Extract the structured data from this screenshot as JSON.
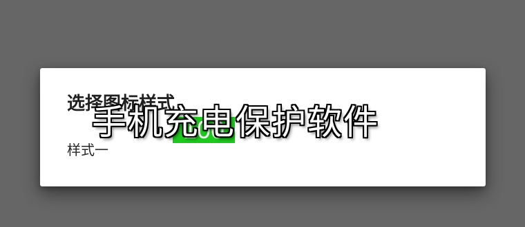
{
  "dialog": {
    "title": "选择图标样式",
    "options": [
      {
        "label": "样式一",
        "preview_value": "100",
        "preview_color": "#1ec81e"
      }
    ]
  },
  "overlay": {
    "title": "手机充电保护软件"
  },
  "colors": {
    "backdrop": "#666666",
    "dialog_background": "#ffffff"
  }
}
